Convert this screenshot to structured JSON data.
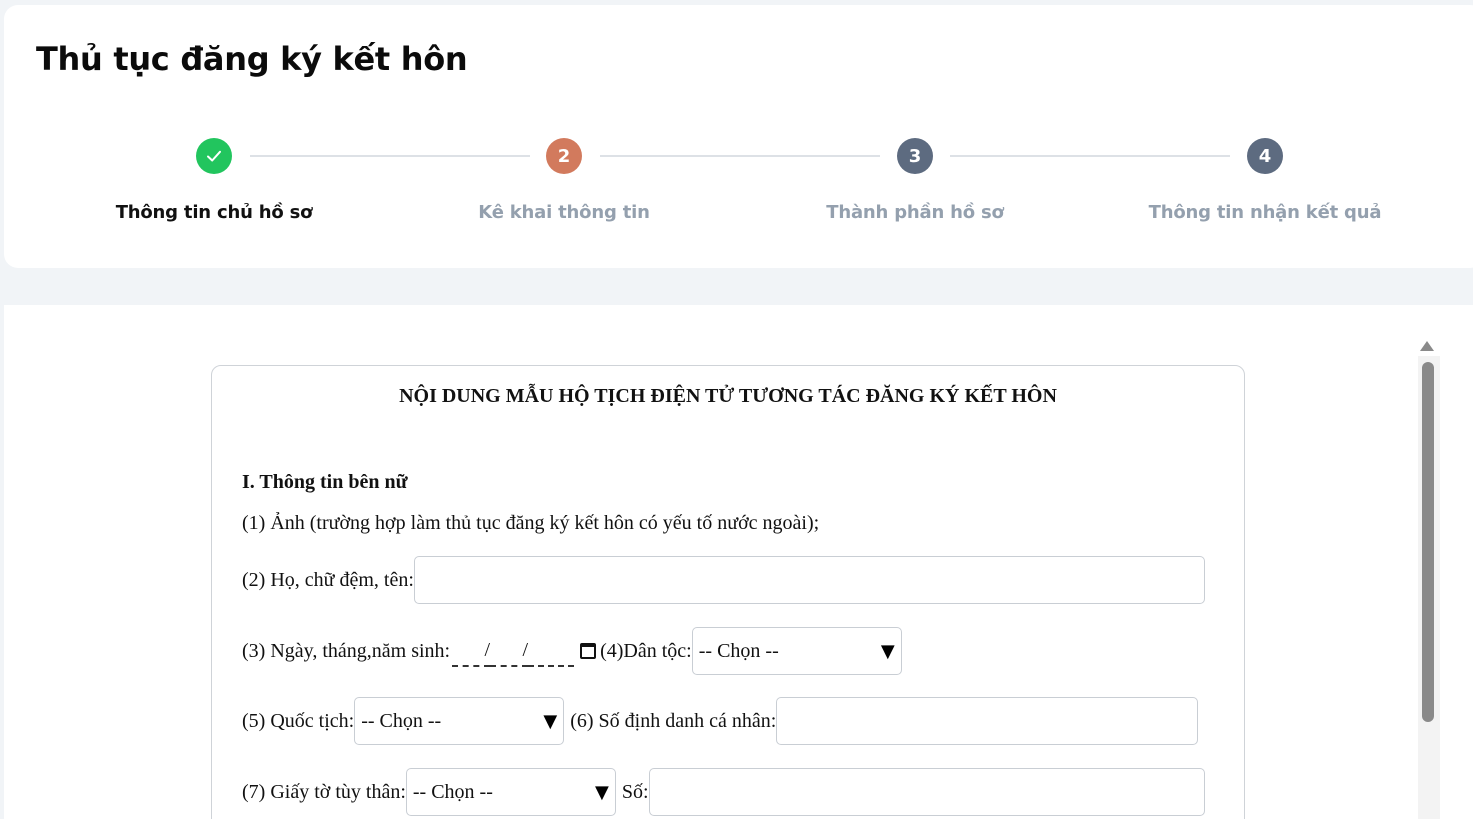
{
  "header": {
    "title": "Thủ tục đăng ký kết hôn"
  },
  "stepper": {
    "steps": [
      {
        "number": "",
        "label": "Thông tin chủ hồ sơ",
        "state": "done"
      },
      {
        "number": "2",
        "label": "Kê khai thông tin",
        "state": "active"
      },
      {
        "number": "3",
        "label": "Thành phần hồ sơ",
        "state": "pending"
      },
      {
        "number": "4",
        "label": "Thông tin nhận kết quả",
        "state": "pending"
      }
    ],
    "colors": {
      "done": "#22c55e",
      "active": "#d27a5d",
      "pending": "#5d6b80"
    }
  },
  "form": {
    "title": "NỘI DUNG MẪU HỘ TỊCH ĐIỆN TỬ TƯƠNG TÁC ĐĂNG KÝ KẾT HÔN",
    "section1_title": "I. Thông tin bên nữ",
    "photo_label": "(1) Ảnh (trường hợp làm thủ tục đăng ký kết hôn có yếu tố nước ngoài);",
    "fullname_label": "(2) Họ, chữ đệm, tên:",
    "fullname_value": "",
    "dob_label": "(3) Ngày, tháng,năm sinh:",
    "dob_sep1": "/",
    "dob_sep2": "/",
    "ethnicity_label": "(4)Dân tộc:",
    "ethnicity_value": "-- Chọn --",
    "nationality_label": "(5) Quốc tịch:",
    "nationality_value": "-- Chọn --",
    "personal_id_label": "(6) Số định danh cá nhân:",
    "personal_id_value": "",
    "id_doc_label": "(7) Giấy tờ tùy thân:",
    "id_doc_value": "-- Chọn --",
    "id_number_label": "Số:",
    "id_number_value": ""
  }
}
